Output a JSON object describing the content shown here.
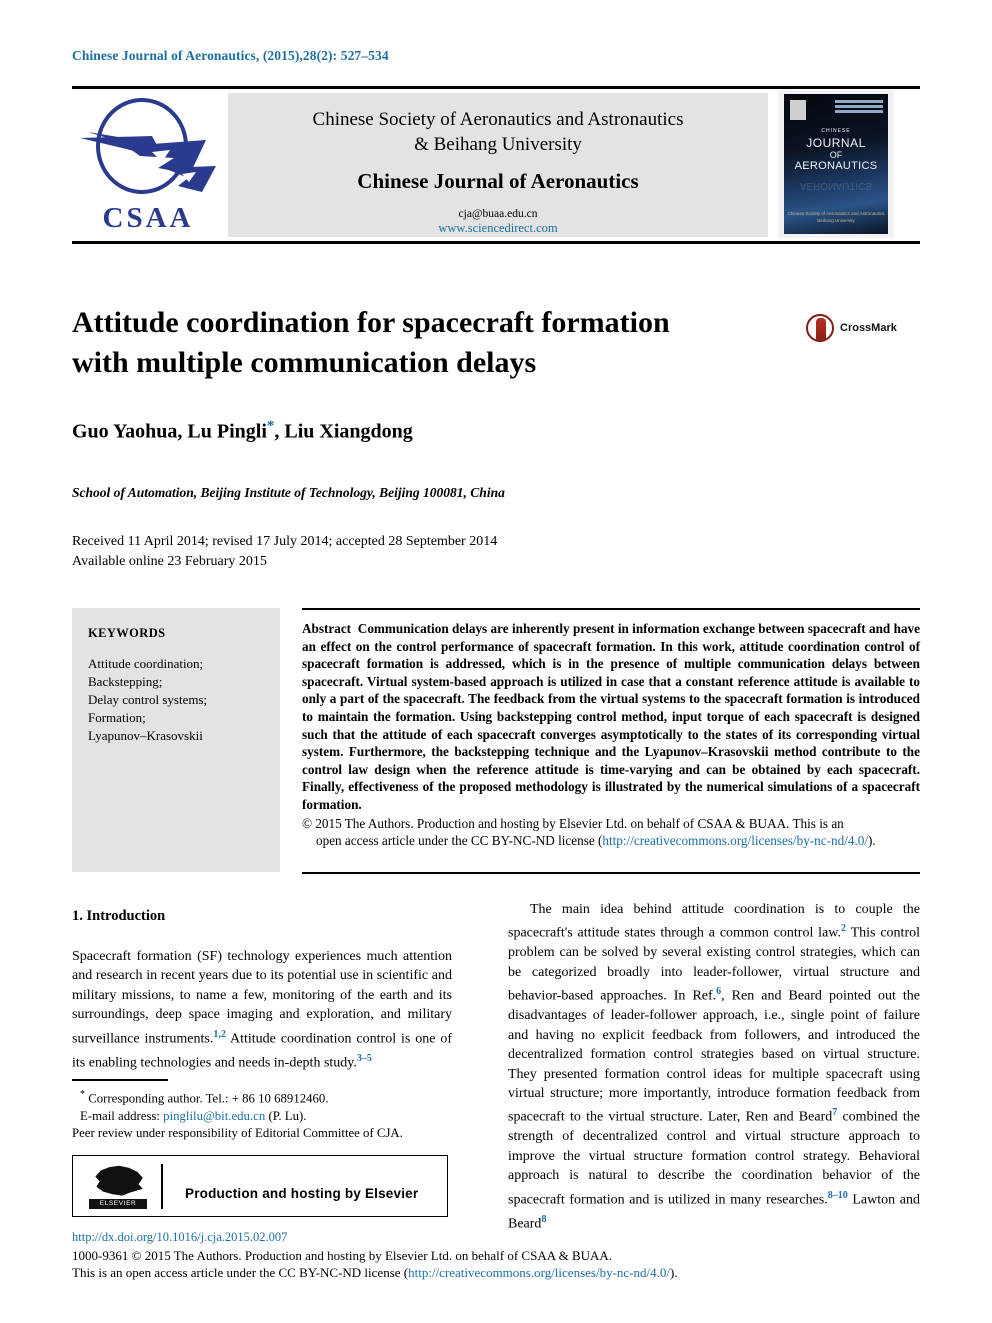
{
  "running_head": "Chinese Journal of Aeronautics, (2015),28(2): 527–534",
  "masthead": {
    "logo_text": "CSAA",
    "logo_icon": "csaa-aircraft-logo",
    "society_line1": "Chinese Society of Aeronautics and Astronautics",
    "society_line2": "& Beihang University",
    "journal_name": "Chinese Journal of Aeronautics",
    "email": "cja@buaa.edu.cn",
    "website": "www.sciencedirect.com",
    "cover": {
      "label_chinese": "CHINESE",
      "label_journal": "JOURNAL",
      "label_of": "OF",
      "label_aeronautics": "AERONAUTICS",
      "bottom_line1": "Chinese Society of Aeronautics and Astronautics",
      "bottom_line2": "Beihang University"
    }
  },
  "article": {
    "title_line1": "Attitude coordination for spacecraft formation",
    "title_line2": "with multiple communication delays",
    "crossmark_label": "CrossMark",
    "authors": "Guo Yaohua, Lu Pingli",
    "authors_tail": ", Liu Xiangdong",
    "corresponding_marker": "*",
    "affiliation": "School of Automation, Beijing Institute of Technology, Beijing 100081, China",
    "history_line1": "Received 11 April 2014; revised 17 July 2014; accepted 28 September 2014",
    "history_line2": "Available online 23 February 2015"
  },
  "keywords": {
    "heading": "KEYWORDS",
    "items": [
      "Attitude coordination;",
      "Backstepping;",
      "Delay control systems;",
      "Formation;",
      "Lyapunov–Krasovskii"
    ]
  },
  "abstract": {
    "label": "Abstract",
    "body": "Communication delays are inherently present in information exchange between spacecraft and have an effect on the control performance of spacecraft formation. In this work, attitude coordination control of spacecraft formation is addressed, which is in the presence of multiple communication delays between spacecraft. Virtual system-based approach is utilized in case that a constant reference attitude is available to only a part of the spacecraft. The feedback from the virtual systems to the spacecraft formation is introduced to maintain the formation. Using backstepping control method, input torque of each spacecraft is designed such that the attitude of each spacecraft converges asymptotically to the states of its corresponding virtual system. Furthermore, the backstepping technique and the Lyapunov–Krasovskii method contribute to the control law design when the reference attitude is time-varying and can be obtained by each spacecraft. Finally, effectiveness of the proposed methodology is illustrated by the numerical simulations of a spacecraft formation.",
    "copyright_line1": "© 2015 The Authors. Production and hosting by Elsevier Ltd. on behalf of CSAA & BUAA.  This is an",
    "copyright_line2_pre": "open access article under the CC BY-NC-ND license (",
    "copyright_link": "http://creativecommons.org/licenses/by-nc-nd/4.0/",
    "copyright_line2_post": ")."
  },
  "body": {
    "section_heading": "1. Introduction",
    "left_paragraph_pre": "Spacecraft formation (SF) technology experiences much attention and research in recent years due to its potential use in scientific and military missions, to name a few, monitoring of the earth and its surroundings, deep space imaging and exploration, and military surveillance instruments.",
    "left_ref_1": "1,2",
    "left_paragraph_mid": " Attitude coordination control is one of its enabling technologies and needs in-depth study.",
    "left_ref_2": "3–5",
    "right_paragraph_pre": "The main idea behind attitude coordination is to couple the spacecraft's attitude states through a common control law.",
    "right_ref_1": "2",
    "right_paragraph_2": " This control problem can be solved by several existing control strategies, which can be categorized broadly into leader-follower, virtual structure and behavior-based approaches. In Ref.",
    "right_ref_2": "6",
    "right_paragraph_3": ", Ren and Beard pointed out the disadvantages of leader-follower approach, i.e., single point of failure and having no explicit feedback from followers, and introduced the decentralized formation control strategies based on virtual structure. They presented formation control ideas for multiple spacecraft using virtual structure; more importantly, introduce formation feedback from spacecraft to the virtual structure. Later, Ren and Beard",
    "right_ref_3": "7",
    "right_paragraph_4": " combined the strength of decentralized control and virtual structure approach to improve the virtual structure formation control strategy. Behavioral approach is natural to describe the coordination behavior of the spacecraft formation and is utilized in many researches.",
    "right_ref_4": "8–10",
    "right_paragraph_5": " Lawton and Beard",
    "right_ref_5": "8"
  },
  "footnotes": {
    "corresponding": "Corresponding author. Tel.: + 86 10 68912460.",
    "email_label": "E-mail address:",
    "email_value": "pinglilu@bit.edu.cn",
    "email_suffix": "(P. Lu).",
    "peer_review": "Peer review under responsibility of Editorial Committee of CJA."
  },
  "elsevier_box": {
    "logo_word": "ELSEVIER",
    "text": "Production and hosting by Elsevier"
  },
  "footer": {
    "doi": "http://dx.doi.org/10.1016/j.cja.2015.02.007",
    "issn_line": "1000-9361 © 2015 The Authors. Production and hosting by Elsevier Ltd. on behalf of CSAA & BUAA.",
    "license_pre": "This is an open access article under the CC BY-NC-ND license (",
    "license_link": "http://creativecommons.org/licenses/by-nc-nd/4.0/",
    "license_post": ")."
  },
  "colors": {
    "link": "#1a6fa3",
    "logo_blue": "#2a3b8f",
    "panel_gray": "#e3e3e3"
  }
}
